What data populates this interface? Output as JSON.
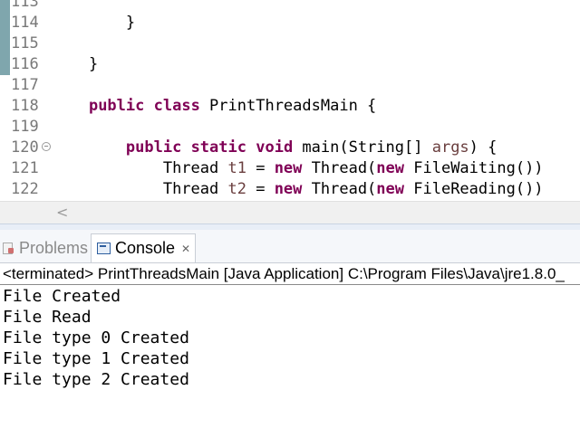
{
  "editor": {
    "lines": [
      {
        "num": "113",
        "quickdiff": true,
        "fold": false,
        "indent": "",
        "segments": []
      },
      {
        "num": "114",
        "quickdiff": true,
        "fold": false,
        "indent": "        ",
        "segments": [
          {
            "t": "}",
            "c": ""
          }
        ]
      },
      {
        "num": "115",
        "quickdiff": true,
        "fold": false,
        "indent": "",
        "segments": []
      },
      {
        "num": "116",
        "quickdiff": true,
        "fold": false,
        "indent": "    ",
        "segments": [
          {
            "t": "}",
            "c": ""
          }
        ]
      },
      {
        "num": "117",
        "quickdiff": false,
        "fold": false,
        "indent": "",
        "segments": []
      },
      {
        "num": "118",
        "quickdiff": false,
        "fold": false,
        "indent": "    ",
        "segments": [
          {
            "t": "public",
            "c": "kw"
          },
          {
            "t": " ",
            "c": ""
          },
          {
            "t": "class",
            "c": "kw"
          },
          {
            "t": " PrintThreadsMain {",
            "c": ""
          }
        ]
      },
      {
        "num": "119",
        "quickdiff": false,
        "fold": false,
        "indent": "",
        "segments": []
      },
      {
        "num": "120",
        "quickdiff": false,
        "fold": true,
        "indent": "        ",
        "segments": [
          {
            "t": "public",
            "c": "kw"
          },
          {
            "t": " ",
            "c": ""
          },
          {
            "t": "static",
            "c": "kw"
          },
          {
            "t": " ",
            "c": ""
          },
          {
            "t": "void",
            "c": "kw"
          },
          {
            "t": " main(String[] ",
            "c": ""
          },
          {
            "t": "args",
            "c": "var"
          },
          {
            "t": ") {",
            "c": ""
          }
        ]
      },
      {
        "num": "121",
        "quickdiff": false,
        "fold": false,
        "indent": "            ",
        "segments": [
          {
            "t": "Thread ",
            "c": ""
          },
          {
            "t": "t1",
            "c": "var"
          },
          {
            "t": " = ",
            "c": ""
          },
          {
            "t": "new",
            "c": "kw"
          },
          {
            "t": " Thread(",
            "c": ""
          },
          {
            "t": "new",
            "c": "kw"
          },
          {
            "t": " FileWaiting())",
            "c": ""
          }
        ]
      },
      {
        "num": "122",
        "quickdiff": false,
        "fold": false,
        "indent": "            ",
        "segments": [
          {
            "t": "Thread ",
            "c": ""
          },
          {
            "t": "t2",
            "c": "var"
          },
          {
            "t": " = ",
            "c": ""
          },
          {
            "t": "new",
            "c": "kw"
          },
          {
            "t": " Thread(",
            "c": ""
          },
          {
            "t": "new",
            "c": "kw"
          },
          {
            "t": " FileReading())",
            "c": ""
          }
        ]
      }
    ],
    "scroll_left_arrow": "<"
  },
  "tabs": {
    "problems_label": "Problems",
    "console_label": "Console",
    "close_glyph": "✕"
  },
  "console": {
    "status": "<terminated> PrintThreadsMain [Java Application] C:\\Program Files\\Java\\jre1.8.0_",
    "output": [
      "File Created",
      "File Read",
      "File type 0 Created",
      "File type 1 Created",
      "File type 2 Created"
    ]
  }
}
